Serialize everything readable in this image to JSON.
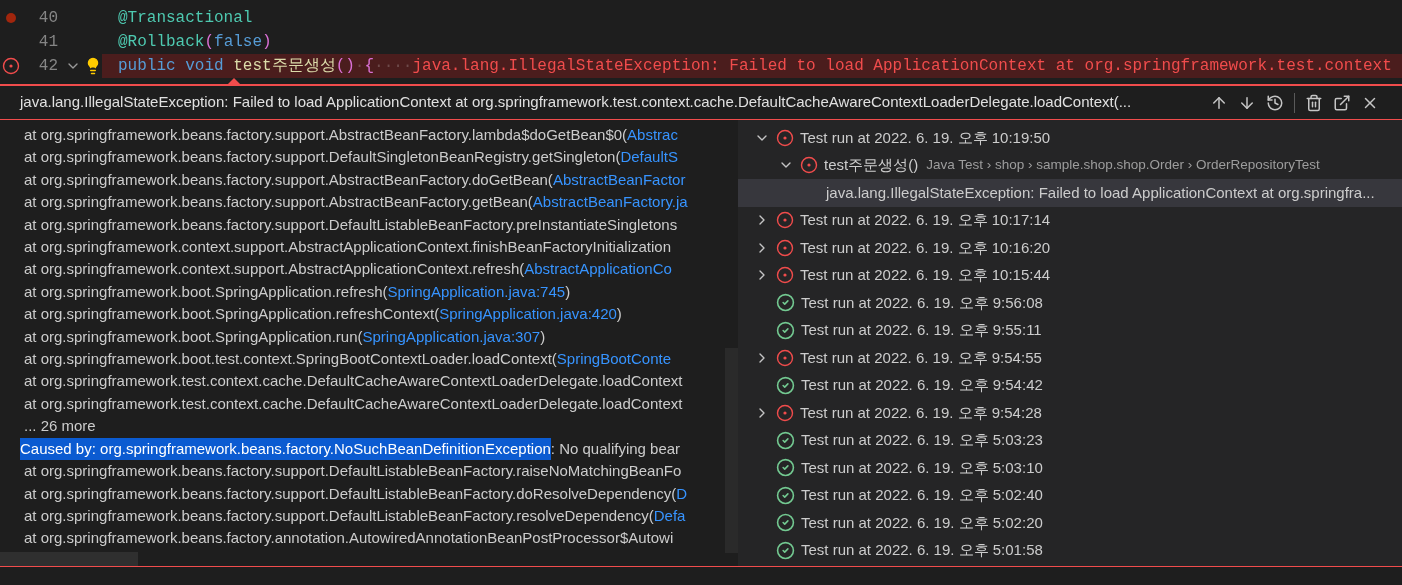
{
  "editor": {
    "lines": [
      {
        "number": "40",
        "breakpoint": true,
        "tokens": [
          {
            "kind": "annotation",
            "text": "@Transactional"
          }
        ]
      },
      {
        "number": "41",
        "tokens": [
          {
            "kind": "annotation",
            "text": "@Rollback"
          },
          {
            "kind": "paren",
            "text": "("
          },
          {
            "kind": "keyword",
            "text": "false"
          },
          {
            "kind": "paren",
            "text": ")"
          }
        ]
      },
      {
        "number": "42",
        "error": true,
        "foldable": true,
        "lightbulb": true,
        "highlighted": true,
        "tokens": [
          {
            "kind": "keyword",
            "text": "public void "
          },
          {
            "kind": "method",
            "text": "test주문생성"
          },
          {
            "kind": "paren2",
            "text": "()"
          },
          {
            "kind": "whitespace",
            "text": "·"
          },
          {
            "kind": "paren3",
            "text": "{"
          },
          {
            "kind": "whitespace",
            "text": "····"
          },
          {
            "kind": "error",
            "text": "java.lang.IllegalStateException: Failed to load ApplicationContext at org.springframework.test.context"
          }
        ]
      }
    ]
  },
  "peek": {
    "title": "java.lang.IllegalStateException: Failed to load ApplicationContext at org.springframework.test.context.cache.DefaultCacheAwareContextLoaderDelegate.loadContext(...",
    "stack": [
      {
        "kind": "frame",
        "text": "at org.springframework.beans.factory.support.AbstractBeanFactory.lambda$doGetBean$0(",
        "link": "Abstrac"
      },
      {
        "kind": "frame",
        "text": "at org.springframework.beans.factory.support.DefaultSingletonBeanRegistry.getSingleton(",
        "link": "DefaultS"
      },
      {
        "kind": "frame",
        "text": "at org.springframework.beans.factory.support.AbstractBeanFactory.doGetBean(",
        "link": "AbstractBeanFactor"
      },
      {
        "kind": "frame",
        "text": "at org.springframework.beans.factory.support.AbstractBeanFactory.getBean(",
        "link": "AbstractBeanFactory.ja"
      },
      {
        "kind": "frame",
        "text": "at org.springframework.beans.factory.support.DefaultListableBeanFactory.preInstantiateSingletons"
      },
      {
        "kind": "frame",
        "text": "at org.springframework.context.support.AbstractApplicationContext.finishBeanFactoryInitialization"
      },
      {
        "kind": "frame",
        "text": "at org.springframework.context.support.AbstractApplicationContext.refresh(",
        "link": "AbstractApplicationCo"
      },
      {
        "kind": "frame",
        "text": "at org.springframework.boot.SpringApplication.refresh(",
        "link": "SpringApplication.java:745",
        "after": ")"
      },
      {
        "kind": "frame",
        "text": "at org.springframework.boot.SpringApplication.refreshContext(",
        "link": "SpringApplication.java:420",
        "after": ")"
      },
      {
        "kind": "frame",
        "text": "at org.springframework.boot.SpringApplication.run(",
        "link": "SpringApplication.java:307",
        "after": ")"
      },
      {
        "kind": "frame",
        "text": "at org.springframework.boot.test.context.SpringBootContextLoader.loadContext(",
        "link": "SpringBootConte"
      },
      {
        "kind": "frame",
        "text": "at org.springframework.test.context.cache.DefaultCacheAwareContextLoaderDelegate.loadContext"
      },
      {
        "kind": "frame",
        "text": "at org.springframework.test.context.cache.DefaultCacheAwareContextLoaderDelegate.loadContext"
      },
      {
        "kind": "more",
        "text": "... 26 more"
      },
      {
        "kind": "caused",
        "selection": "Caused by: org.springframework.beans.factory.NoSuchBeanDefinitionException",
        "text": ": No qualifying bear"
      },
      {
        "kind": "frame",
        "text": "at org.springframework.beans.factory.support.DefaultListableBeanFactory.raiseNoMatchingBeanFo"
      },
      {
        "kind": "frame",
        "text": "at org.springframework.beans.factory.support.DefaultListableBeanFactory.doResolveDependency(",
        "link": "D"
      },
      {
        "kind": "frame",
        "text": "at org.springframework.beans.factory.support.DefaultListableBeanFactory.resolveDependency(",
        "link": "Defa"
      },
      {
        "kind": "frame",
        "text": "at org.springframework.beans.factory.annotation.AutowiredAnnotationBeanPostProcessor$Autowi"
      }
    ],
    "runs": [
      {
        "failed": true,
        "expanded": true,
        "selected": false,
        "label": "Test run at 2022. 6. 19. 오후 10:19:50",
        "children": [
          {
            "failed": true,
            "expanded": true,
            "selected": false,
            "label": "test주문생성()",
            "detail": "Java Test › shop › sample.shop.shop.Order › OrderRepositoryTest",
            "children": [
              {
                "selected": true,
                "label": "java.lang.IllegalStateException: Failed to load ApplicationContext at org.springfra..."
              }
            ]
          }
        ]
      },
      {
        "failed": true,
        "expanded": false,
        "selected": false,
        "label": "Test run at 2022. 6. 19. 오후 10:17:14"
      },
      {
        "failed": true,
        "expanded": false,
        "selected": false,
        "label": "Test run at 2022. 6. 19. 오후 10:16:20"
      },
      {
        "failed": true,
        "expanded": false,
        "selected": false,
        "label": "Test run at 2022. 6. 19. 오후 10:15:44"
      },
      {
        "failed": false,
        "selected": false,
        "label": "Test run at 2022. 6. 19. 오후 9:56:08"
      },
      {
        "failed": false,
        "selected": false,
        "label": "Test run at 2022. 6. 19. 오후 9:55:11"
      },
      {
        "failed": true,
        "expanded": false,
        "selected": false,
        "label": "Test run at 2022. 6. 19. 오후 9:54:55"
      },
      {
        "failed": false,
        "selected": false,
        "label": "Test run at 2022. 6. 19. 오후 9:54:42"
      },
      {
        "failed": true,
        "expanded": false,
        "selected": false,
        "label": "Test run at 2022. 6. 19. 오후 9:54:28"
      },
      {
        "failed": false,
        "selected": false,
        "label": "Test run at 2022. 6. 19. 오후 5:03:23"
      },
      {
        "failed": false,
        "selected": false,
        "label": "Test run at 2022. 6. 19. 오후 5:03:10"
      },
      {
        "failed": false,
        "selected": false,
        "label": "Test run at 2022. 6. 19. 오후 5:02:40"
      },
      {
        "failed": false,
        "selected": false,
        "label": "Test run at 2022. 6. 19. 오후 5:02:20"
      },
      {
        "failed": false,
        "selected": false,
        "label": "Test run at 2022. 6. 19. 오후 5:01:58"
      }
    ]
  }
}
